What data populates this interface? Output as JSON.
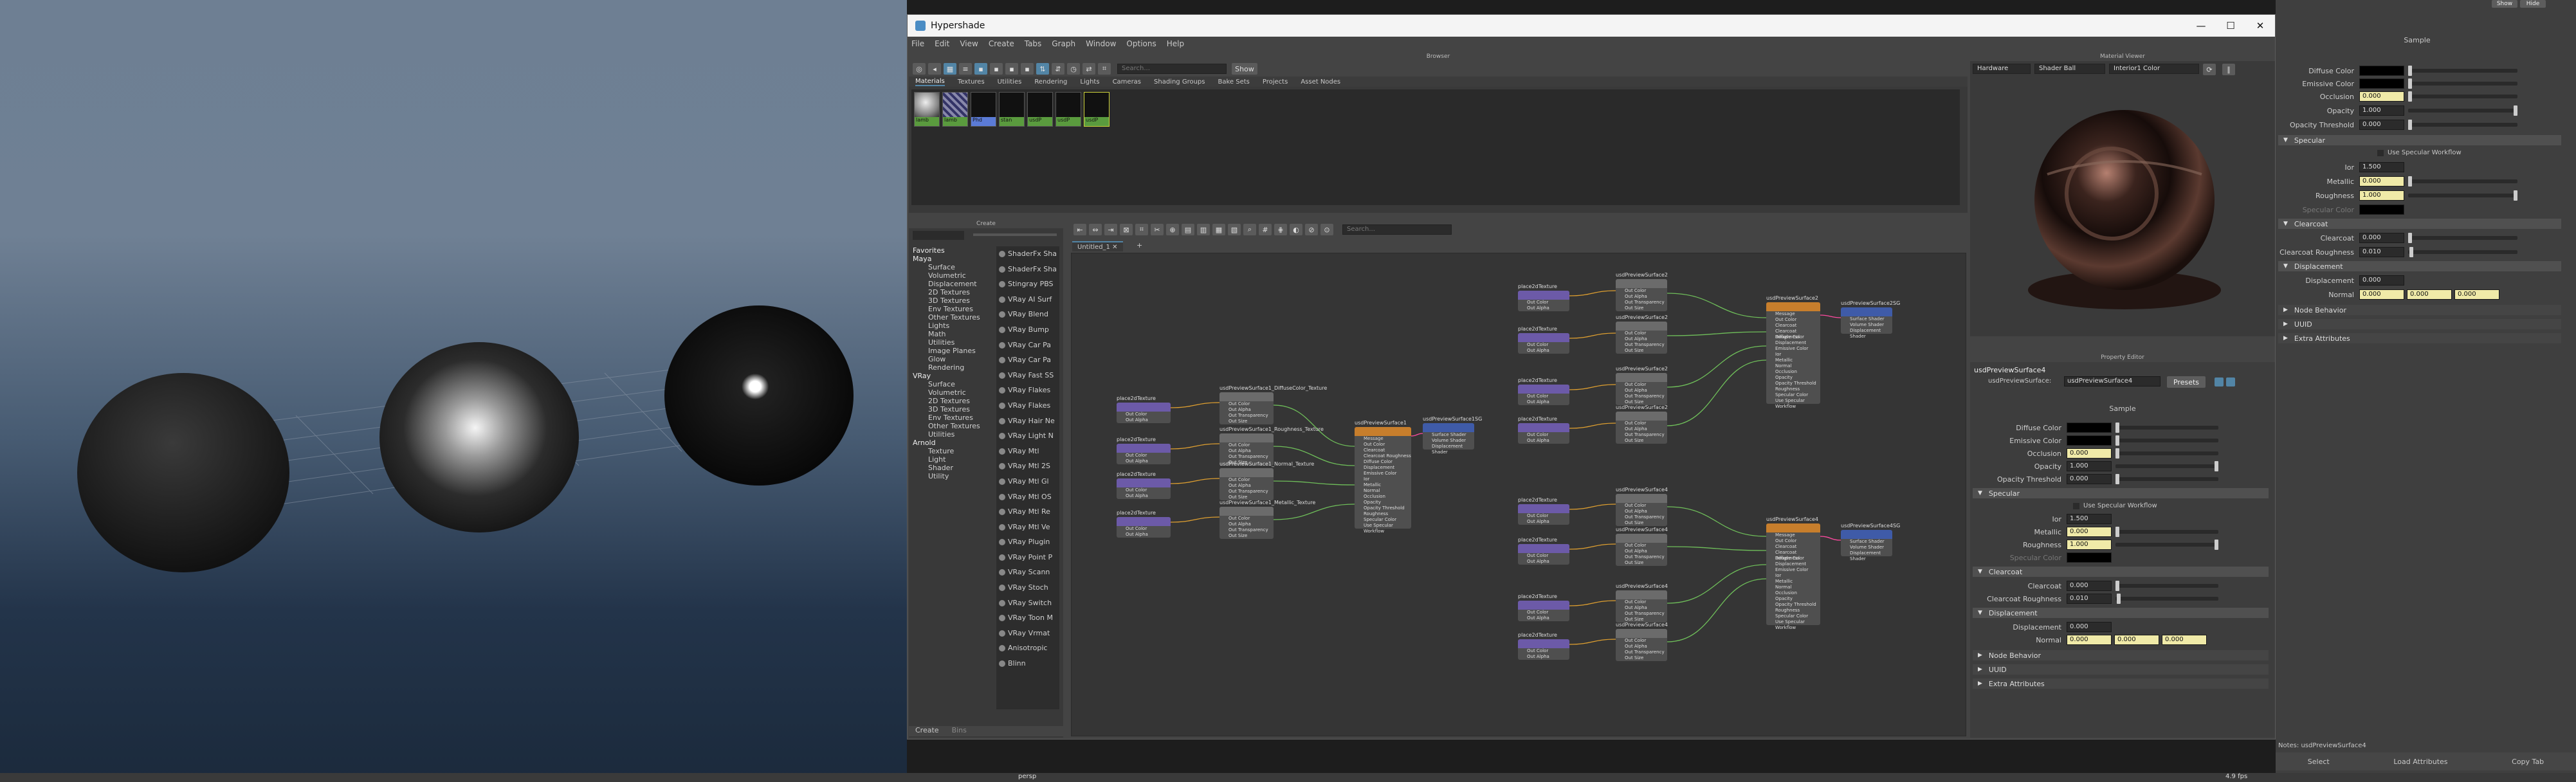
{
  "viewport": {
    "camera": "persp",
    "fps": "4.9 fps"
  },
  "hypershade": {
    "title": "Hypershade",
    "menu": [
      "File",
      "Edit",
      "View",
      "Create",
      "Tabs",
      "Graph",
      "Window",
      "Options",
      "Help"
    ],
    "browser": {
      "title": "Browser",
      "search_placeholder": "Search...",
      "show_label": "Show",
      "tabs": [
        "Materials",
        "Textures",
        "Utilities",
        "Rendering",
        "Lights",
        "Cameras",
        "Shading Groups",
        "Bake Sets",
        "Projects",
        "Asset Nodes"
      ],
      "swatches": [
        "lamb",
        "lamb",
        "Phd",
        "stan",
        "usdP",
        "usdP",
        "usdP"
      ]
    },
    "create": {
      "title": "Create",
      "tree": [
        "Favorites",
        "Maya",
        "Surface",
        "Volumetric",
        "Displacement",
        "2D Textures",
        "3D Textures",
        "Env Textures",
        "Other Textures",
        "Lights",
        "Math",
        "Utilities",
        "Image Planes",
        "Glow",
        "Rendering",
        "VRay",
        "Surface",
        "Volumetric",
        "2D Textures",
        "3D Textures",
        "Env Textures",
        "Other Textures",
        "Utilities",
        "Arnold",
        "Texture",
        "Light",
        "Shader",
        "Utility"
      ],
      "list": [
        "ShaderFx Sha",
        "ShaderFx Sha",
        "Stingray PBS",
        "VRay AI Surf",
        "VRay Blend",
        "VRay Bump",
        "VRay Car Pa",
        "VRay Car Pa",
        "VRay Fast SS",
        "VRay Flakes",
        "VRay Flakes",
        "VRay Hair Ne",
        "VRay Light N",
        "VRay Mtl",
        "VRay Mtl 2S",
        "VRay Mtl Gl",
        "VRay Mtl OS",
        "VRay Mtl Re",
        "VRay Mtl Ve",
        "VRay Plugin",
        "VRay Point P",
        "VRay Scann",
        "VRay Stoch",
        "VRay Switch",
        "VRay Toon M",
        "VRay Vrmat",
        "Anisotropic",
        "Blinn"
      ],
      "bottom_tabs": [
        "Create",
        "Bins"
      ]
    },
    "graph": {
      "search_placeholder": "Search...",
      "tab_label": "Untitled_1",
      "nodes_left": {
        "textures": [
          "place2dTexture",
          "place2dTexture",
          "place2dTexture",
          "place2dTexture"
        ],
        "readers": [
          "usdPreviewSurface1_DiffuseColor_Texture",
          "usdPreviewSurface1_Roughness_Texture",
          "usdPreviewSurface1_Normal_Texture",
          "usdPreviewSurface1_Metallic_Texture"
        ],
        "shader": "usdPreviewSurface1",
        "sg": "usdPreviewSurface1SG"
      },
      "nodes_right": {
        "shader_a": "usdPreviewSurface2",
        "sg_a": "usdPreviewSurface2SG",
        "shader_b": "usdPreviewSurface4",
        "sg_b": "usdPreviewSurface4SG",
        "place2d": "place2dTexture",
        "file_rows": [
          "Out Color",
          "Out Alpha",
          "Out Transparency",
          "Out Size"
        ],
        "shader_rows": [
          "Message",
          "Out Color",
          "Clearcoat",
          "Clearcoat Roughness",
          "Diffuse Color",
          "Displacement",
          "Emissive Color",
          "Ior",
          "Metallic",
          "Normal",
          "Occlusion",
          "Opacity",
          "Opacity Threshold",
          "Roughness",
          "Specular Color",
          "Use Specular Workflow"
        ],
        "sg_rows": [
          "Surface Shader",
          "Volume Shader",
          "Displacement Shader"
        ]
      }
    }
  },
  "material_viewer": {
    "title": "Material Viewer",
    "renderer": "Hardware",
    "shape": "Shader Ball",
    "env": "Interior1 Color"
  },
  "property_editor": {
    "title": "Property Editor",
    "node_name": "usdPreviewSurface4",
    "type_label": "usdPreviewSurface:",
    "type_value": "usdPreviewSurface4",
    "presets_label": "Presets",
    "sample_header": "Sample",
    "diffuse_color": "Diffuse Color",
    "emissive_color": "Emissive Color",
    "occlusion_label": "Occlusion",
    "occlusion_value": "0.000",
    "opacity_label": "Opacity",
    "opacity_value": "1.000",
    "opacity_threshold_label": "Opacity Threshold",
    "opacity_threshold_value": "0.000",
    "specular_section": "Specular",
    "use_specular": "Use Specular Workflow",
    "ior_label": "Ior",
    "ior_value": "1.500",
    "metallic_label": "Metallic",
    "metallic_value": "0.000",
    "roughness_label": "Roughness",
    "roughness_value": "1.000",
    "specular_color": "Specular Color",
    "clearcoat_section": "Clearcoat",
    "clearcoat_label": "Clearcoat",
    "clearcoat_value": "0.000",
    "clearcoat_roughness_label": "Clearcoat Roughness",
    "clearcoat_roughness_value": "0.010",
    "displacement_section": "Displacement",
    "displacement_label": "Displacement",
    "displacement_value": "0.000",
    "normal_label": "Normal",
    "normal_values": [
      "0.000",
      "0.000",
      "0.000"
    ],
    "node_behavior": "Node Behavior",
    "uuid": "UUID",
    "extra_attributes": "Extra Attributes"
  },
  "attribute_editor": {
    "show_label": "Show",
    "hide_label": "Hide",
    "sample_header": "Sample",
    "metallic_value": "0.000",
    "roughness_value": "1.000",
    "ior_value": "1.500",
    "notes_label": "Notes:",
    "notes_value": "usdPreviewSurface4",
    "select_label": "Select",
    "load_attributes_label": "Load Attributes",
    "copy_tab_label": "Copy Tab"
  },
  "colors": {
    "accent": "#5285a6",
    "field_highlight": "#f0eaa8",
    "texture_node": "#6c5aa8",
    "shader_node": "#c77e2c",
    "sg_node": "#3f5ba8",
    "file_node": "#6b6b6b"
  }
}
